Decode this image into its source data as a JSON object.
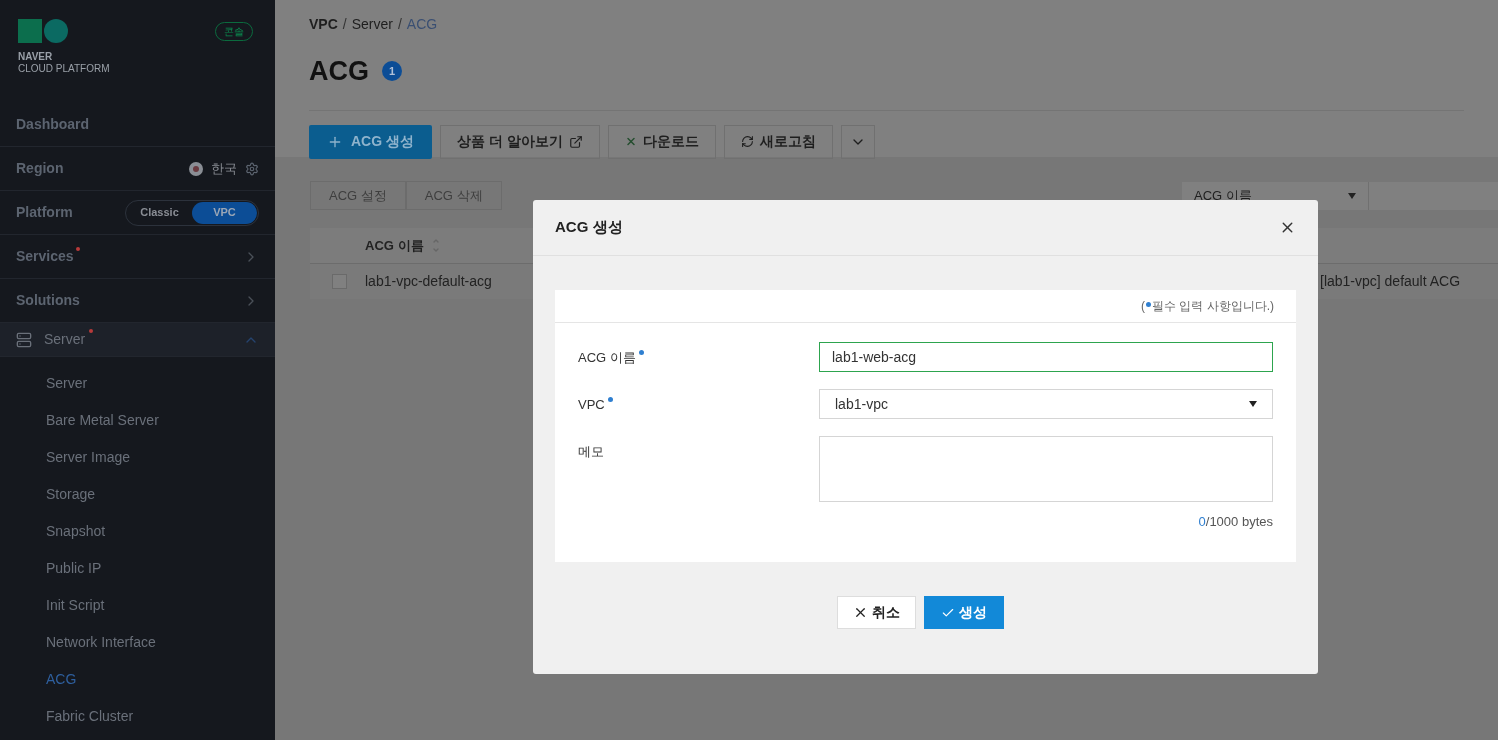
{
  "sidebar": {
    "brand": [
      "NAVER",
      "CLOUD PLATFORM"
    ],
    "console_badge": "콘솔",
    "items": [
      {
        "kind": "link",
        "label": "Dashboard"
      },
      {
        "kind": "region",
        "label": "Region",
        "value": "한국"
      },
      {
        "kind": "platform",
        "label": "Platform",
        "options": [
          {
            "label": "Classic",
            "selected": false
          },
          {
            "label": "VPC",
            "selected": true
          }
        ]
      },
      {
        "kind": "submenu",
        "label": "Services",
        "new": true
      },
      {
        "kind": "submenu",
        "label": "Solutions",
        "new": false
      },
      {
        "kind": "section",
        "label": "Server",
        "new": true,
        "expanded": true,
        "children": [
          {
            "label": "Server",
            "selected": false
          },
          {
            "label": "Bare Metal Server",
            "selected": false
          },
          {
            "label": "Server Image",
            "selected": false
          },
          {
            "label": "Storage",
            "selected": false
          },
          {
            "label": "Snapshot",
            "selected": false
          },
          {
            "label": "Public IP",
            "selected": false
          },
          {
            "label": "Init Script",
            "selected": false
          },
          {
            "label": "Network Interface",
            "selected": false
          },
          {
            "label": "ACG",
            "selected": true
          },
          {
            "label": "Fabric Cluster",
            "selected": false
          }
        ]
      }
    ]
  },
  "breadcrumb": [
    {
      "label": "VPC",
      "current": false,
      "separator": "/"
    },
    {
      "label": "Server",
      "current": false,
      "separator": "/"
    },
    {
      "label": "ACG",
      "current": true
    }
  ],
  "page_title": "ACG",
  "count": "1",
  "toolbar": [
    {
      "kind": "primary",
      "label": "ACG 생성"
    },
    {
      "kind": "external",
      "label": "상품 더 알아보기"
    },
    {
      "kind": "excel",
      "label": "다운로드"
    },
    {
      "kind": "refresh",
      "label": "새로고침"
    },
    {
      "kind": "more"
    }
  ],
  "actions": [
    {
      "label": "ACG 설정",
      "disabled": true
    },
    {
      "label": "ACG 삭제",
      "disabled": true
    }
  ],
  "filter": {
    "value": "ACG 이름"
  },
  "table": {
    "columns": [
      "ACG 이름"
    ],
    "rows": [
      {
        "checked": false,
        "name": "lab1-vpc-default-acg",
        "memo": "[lab1-vpc] default ACG"
      }
    ]
  },
  "dialog": {
    "title": "ACG 생성",
    "required_note": {
      "open": "(",
      "text": "필수 입력 사항입니다.)"
    },
    "fields": [
      {
        "kind": "text",
        "label": "ACG 이름",
        "required": true,
        "value": "lab1-web-acg",
        "focused": true
      },
      {
        "kind": "select",
        "label": "VPC",
        "required": true,
        "value": "lab1-vpc"
      },
      {
        "kind": "textarea",
        "label": "메모",
        "required": false,
        "count": "0",
        "limit": "/1000 bytes"
      }
    ],
    "buttons": [
      {
        "kind": "cancel",
        "label": "취소"
      },
      {
        "kind": "confirm",
        "label": "생성"
      }
    ]
  }
}
